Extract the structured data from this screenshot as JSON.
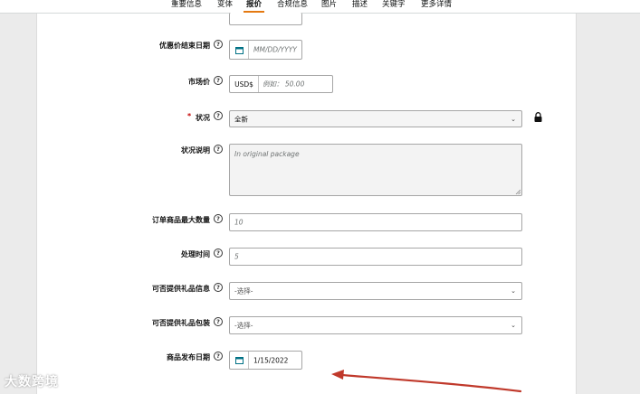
{
  "tabs": [
    {
      "label": "重要信息",
      "active": false
    },
    {
      "label": "变体",
      "active": false
    },
    {
      "label": "报价",
      "active": true
    },
    {
      "label": "合规信息",
      "active": false
    },
    {
      "label": "图片",
      "active": false
    },
    {
      "label": "描述",
      "active": false
    },
    {
      "label": "关键字",
      "active": false
    },
    {
      "label": "更多详情",
      "active": false
    }
  ],
  "form": {
    "sale_end_date": {
      "label": "优惠价结束日期",
      "placeholder": "MM/DD/YYYY"
    },
    "market_price": {
      "label": "市场价",
      "prefix": "USD$",
      "placeholder": "例如： 50.00"
    },
    "condition": {
      "label": "状况",
      "required_mark": "*",
      "value": "全新"
    },
    "condition_note": {
      "label": "状况说明",
      "placeholder": "In original package"
    },
    "max_order_qty": {
      "label": "订单商品最大数量",
      "placeholder": "10"
    },
    "handling_time": {
      "label": "处理时间",
      "placeholder": "5"
    },
    "gift_message": {
      "label": "可否提供礼品信息",
      "value": "-选择-"
    },
    "gift_wrap": {
      "label": "可否提供礼品包装",
      "value": "-选择-"
    },
    "release_date": {
      "label": "商品发布日期",
      "value": "1/15/2022"
    }
  },
  "help_glyph": "?",
  "chevron_glyph": "⌄",
  "watermark": "大数跨境",
  "colors": {
    "accent": "#e47911",
    "arrow": "#c0392b",
    "required": "#c40000"
  }
}
